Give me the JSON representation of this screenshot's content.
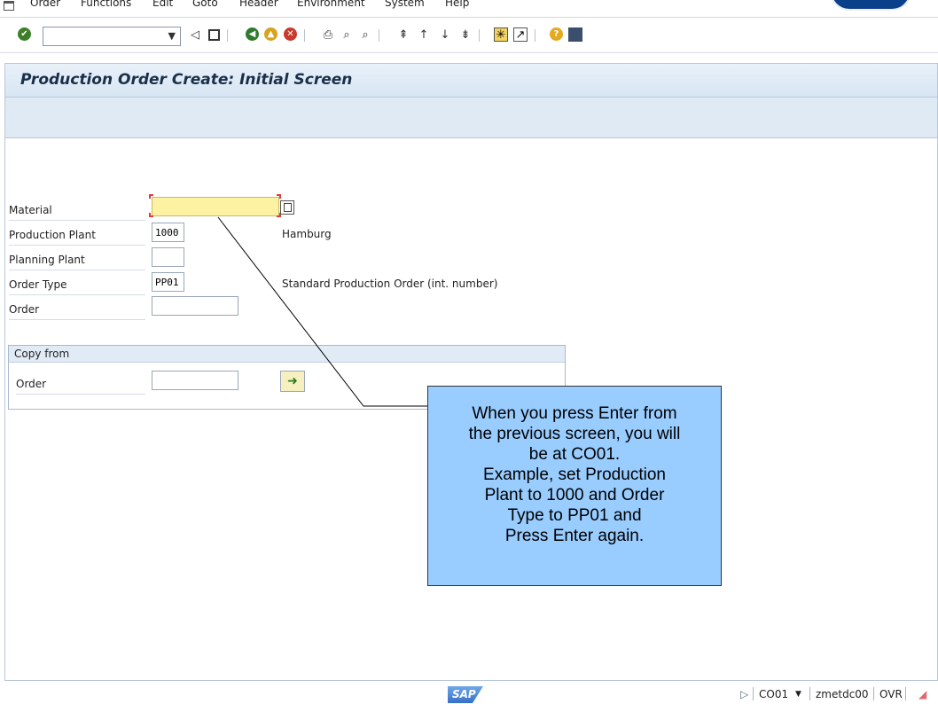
{
  "menu": {
    "items": [
      {
        "label": "Order"
      },
      {
        "label": "Functions"
      },
      {
        "label": "Edit"
      },
      {
        "label": "Goto"
      },
      {
        "label": "Header"
      },
      {
        "label": "Environment"
      },
      {
        "label": "System"
      },
      {
        "label": "Help"
      }
    ]
  },
  "toolbar": {
    "command_value": "",
    "icons": [
      "enter-icon",
      "back-arrow-icon",
      "save-icon",
      "back-icon",
      "exit-icon",
      "cancel-icon",
      "print-icon",
      "find-icon",
      "find-next-icon",
      "first-page-icon",
      "previous-page-icon",
      "next-page-icon",
      "last-page-icon",
      "create-session-icon",
      "create-shortcut-icon",
      "help-icon",
      "customize-layout-icon"
    ]
  },
  "screen": {
    "title": "Production Order Create: Initial Screen"
  },
  "form": {
    "material": {
      "label": "Material",
      "value": ""
    },
    "production_plant": {
      "label": "Production Plant",
      "value": "1000",
      "description": "Hamburg"
    },
    "planning_plant": {
      "label": "Planning Plant",
      "value": ""
    },
    "order_type": {
      "label": "Order Type",
      "value": "PP01",
      "description": "Standard Production Order (int. number)"
    },
    "order": {
      "label": "Order",
      "value": ""
    }
  },
  "copy_from": {
    "title": "Copy from",
    "order_label": "Order",
    "order_value": ""
  },
  "callout": {
    "lines": [
      "When you press Enter from",
      "the previous screen, you will",
      "be at CO01.",
      "Example, set Production",
      "Plant to 1000 and Order",
      "Type to PP01 and",
      "Press Enter again."
    ]
  },
  "status": {
    "logo": "SAP",
    "transaction": "CO01",
    "server": "zmetdc00",
    "mode": "OVR"
  },
  "colors": {
    "title_bar": "#d7e5f3",
    "required_field": "#fdf2a2",
    "callout": "#99ccff",
    "brand": "#0a3f8a"
  }
}
